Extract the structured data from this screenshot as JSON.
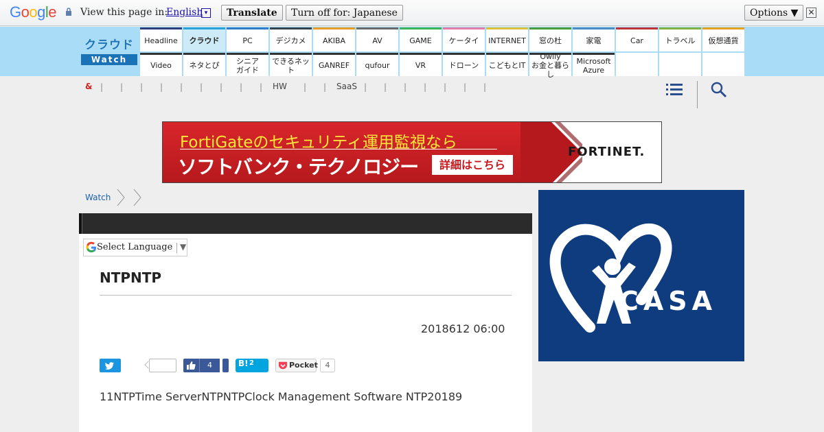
{
  "translate_bar": {
    "brand": "Google",
    "prompt": "View this page in:",
    "language": "English",
    "language_arrow": "▾",
    "translate_label": "Translate",
    "turn_off_label": "Turn off for: Japanese",
    "options_label": "Options ▼",
    "close_symbol": "✕"
  },
  "logo": {
    "top": "クラウド",
    "bottom": "Watch"
  },
  "nav": {
    "row1": [
      {
        "label": "Headline",
        "color": "#2a3f7a"
      },
      {
        "label": "クラウド",
        "color": "#2aa3d8",
        "active": true
      },
      {
        "label": "PC",
        "color": "#2f7cc9"
      },
      {
        "label": "デジカメ",
        "color": "#34444e"
      },
      {
        "label": "AKIBA",
        "color": "#e89c24"
      },
      {
        "label": "AV",
        "color": "#6a6a6a"
      },
      {
        "label": "GAME",
        "color": "#3ab35a"
      },
      {
        "label": "ケータイ",
        "color": "#e27ba5"
      },
      {
        "label": "INTERNET",
        "color": "#d9c235"
      },
      {
        "label": "窓の杜",
        "color": "#4a9b3c"
      },
      {
        "label": "家電",
        "color": "#4a8dc4"
      },
      {
        "label": "Car",
        "color": "#c0323a"
      },
      {
        "label": "トラベル",
        "color": "#7fb33d"
      },
      {
        "label": "仮想通貨",
        "color": "#e5a31c"
      }
    ],
    "row2": [
      {
        "label": "Video"
      },
      {
        "label": "ネタとぴ"
      },
      {
        "label": "シニア\nガイド"
      },
      {
        "label": "できるネット"
      },
      {
        "label": "GANREF"
      },
      {
        "label": "qufour"
      },
      {
        "label": "VR"
      },
      {
        "label": "ドローン"
      },
      {
        "label": "こどもとIT"
      },
      {
        "label": "Owlly\nお金と暮らし"
      },
      {
        "label": "Microsoft\nAzure"
      }
    ]
  },
  "subnav": {
    "amp": "&",
    "hw": "HW",
    "saas": "SaaS"
  },
  "banner": {
    "line1": "FortiGateのセキュリティ運用監視なら",
    "line2": "ソフトバンク・テクノロジー",
    "cta": "詳細はこちら",
    "brand": "FORTINET."
  },
  "breadcrumb": {
    "home": "Watch"
  },
  "lang_select": {
    "label": "Select Language",
    "arrow": "▼"
  },
  "article": {
    "title": "NTPNTP",
    "date": "2018612 06:00",
    "body": "11NTPTime ServerNTPNTPClock Management Software NTP20189"
  },
  "share": {
    "fb_count": "4",
    "hatena_label": "B!",
    "hatena_count": "2",
    "pocket_label": "Pocket",
    "pocket_count": "4"
  },
  "side_ad": {
    "brand": "CASA",
    "registered": "®"
  }
}
